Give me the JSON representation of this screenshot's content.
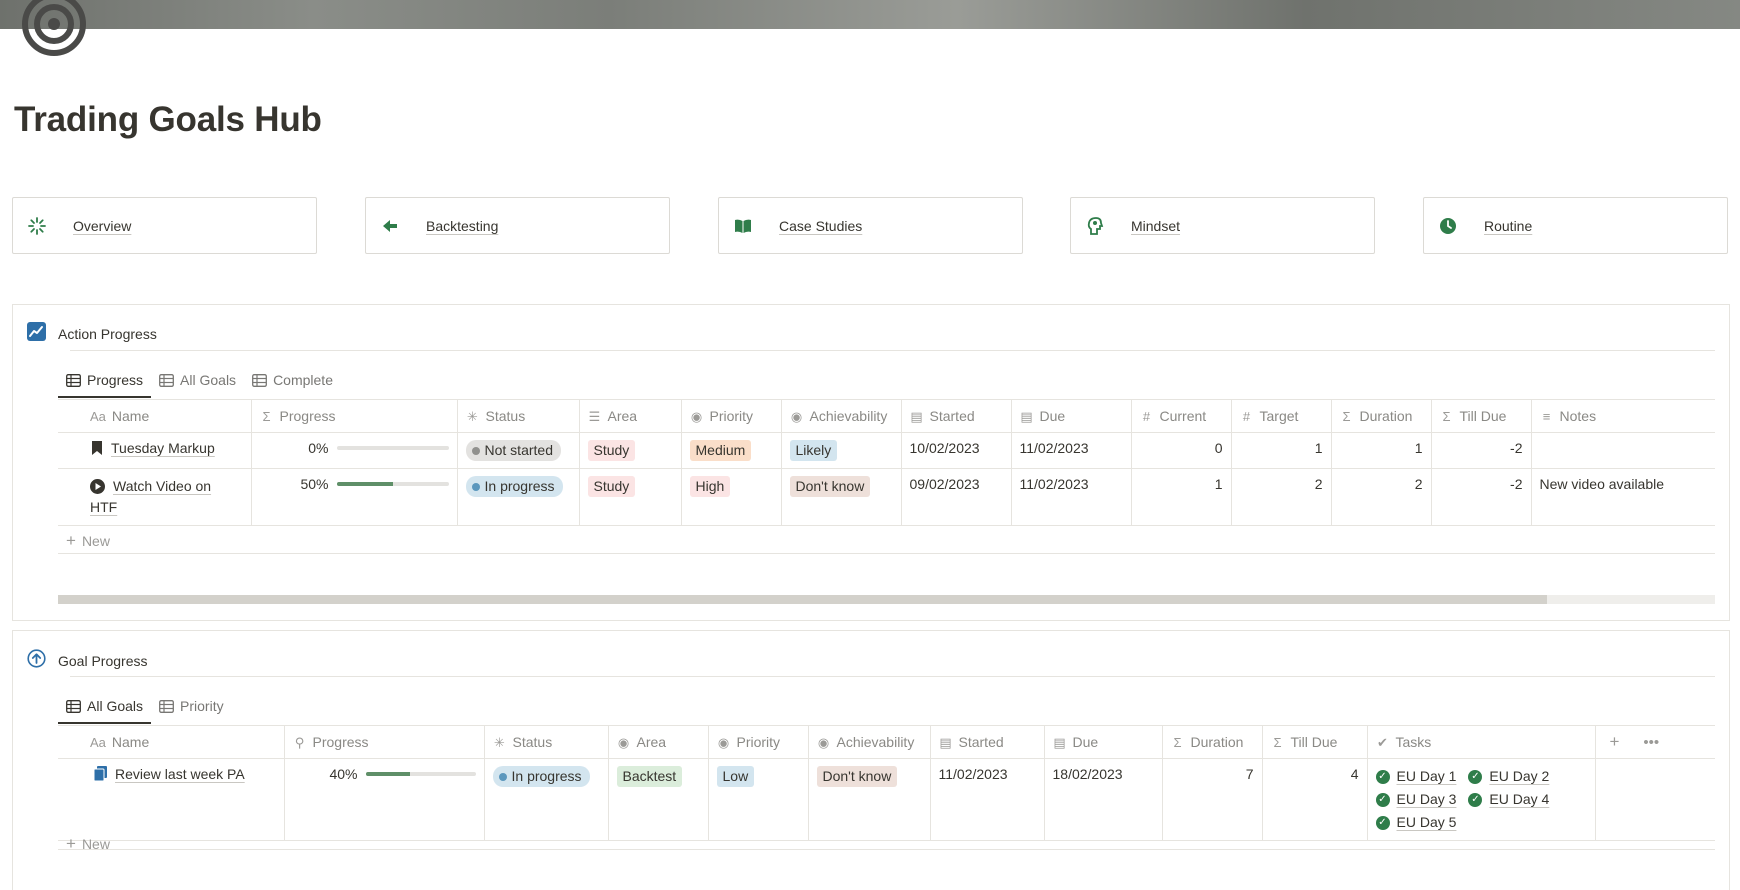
{
  "page": {
    "title": "Trading Goals Hub"
  },
  "nav_cards": [
    {
      "label": "Overview",
      "icon": "sparkle-icon"
    },
    {
      "label": "Backtesting",
      "icon": "arrow-left-icon"
    },
    {
      "label": "Case Studies",
      "icon": "book-icon"
    },
    {
      "label": "Mindset",
      "icon": "head-icon"
    },
    {
      "label": "Routine",
      "icon": "clock-icon"
    }
  ],
  "action_progress": {
    "title": "Action Progress",
    "tabs": [
      {
        "label": "Progress",
        "active": true
      },
      {
        "label": "All Goals",
        "active": false
      },
      {
        "label": "Complete",
        "active": false
      }
    ],
    "columns": [
      "Name",
      "Progress",
      "Status",
      "Area",
      "Priority",
      "Achievability",
      "Started",
      "Due",
      "Current",
      "Target",
      "Duration",
      "Till Due",
      "Notes"
    ],
    "column_icons": [
      "Aa",
      "Σ",
      "status-icon",
      "list-icon",
      "select-icon",
      "select-icon",
      "calendar-icon",
      "calendar-icon",
      "#",
      "#",
      "Σ",
      "Σ",
      "text-icon"
    ],
    "rows": [
      {
        "name": "Tuesday Markup",
        "name_icon": "bookmark-icon",
        "progress_text": "0%",
        "progress": 0,
        "status": "Not started",
        "area": "Study",
        "priority": "Medium",
        "achievability": "Likely",
        "started": "10/02/2023",
        "due": "11/02/2023",
        "current": "0",
        "target": "1",
        "duration": "1",
        "till_due": "-2",
        "notes": ""
      },
      {
        "name": "Watch Video on HTF",
        "name_icon": "play-circle-icon",
        "progress_text": "50%",
        "progress": 0.5,
        "status": "In progress",
        "area": "Study",
        "priority": "High",
        "achievability": "Don't know",
        "started": "09/02/2023",
        "due": "11/02/2023",
        "current": "1",
        "target": "2",
        "duration": "2",
        "till_due": "-2",
        "notes": "New video available"
      }
    ],
    "new_label": "New"
  },
  "goal_progress": {
    "title": "Goal Progress",
    "tabs": [
      {
        "label": "All Goals",
        "active": true
      },
      {
        "label": "Priority",
        "active": false
      }
    ],
    "columns": [
      "Name",
      "Progress",
      "Status",
      "Area",
      "Priority",
      "Achievability",
      "Started",
      "Due",
      "Duration",
      "Till Due",
      "Tasks"
    ],
    "rows": [
      {
        "name": "Review last week PA",
        "name_icon": "document-icon",
        "progress_text": "40%",
        "progress": 0.4,
        "status": "In progress",
        "area": "Backtest",
        "priority": "Low",
        "achievability": "Don't know",
        "started": "11/02/2023",
        "due": "18/02/2023",
        "duration": "7",
        "till_due": "4",
        "tasks": [
          "EU Day 1",
          "EU Day 2",
          "EU Day 3",
          "EU Day 4",
          "EU Day 5"
        ]
      }
    ],
    "new_label": "New"
  },
  "colors": {
    "accent_green": "#2f7d4a",
    "tag_study_bg": "#fbe4e4",
    "tag_medium_bg": "#fadec9",
    "tag_likely_bg": "#d3e5ef",
    "tag_high_bg": "#fbe4e4",
    "tag_dontknow_bg": "#eee0da",
    "tag_backtest_bg": "#dbeddb",
    "tag_low_bg": "#d3e5ef",
    "status_inprogress_bg": "#d3e5ef",
    "status_notstarted_bg": "#e3e2e0"
  }
}
